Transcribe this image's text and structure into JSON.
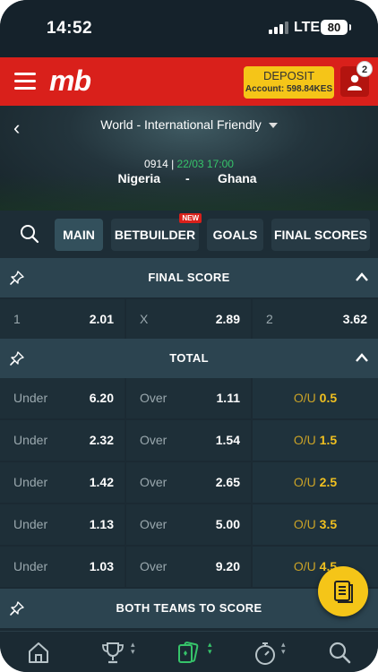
{
  "status_bar": {
    "time": "14:52",
    "network": "LTE",
    "battery": "80"
  },
  "header": {
    "logo": "mb",
    "deposit_label": "DEPOSIT",
    "account_balance": "Account: 598.84KES",
    "notification_count": "2"
  },
  "event": {
    "league": "World - International Friendly",
    "event_id": "0914 |",
    "datetime": "22/03 17:00",
    "home_team": "Nigeria",
    "separator": "-",
    "away_team": "Ghana"
  },
  "tabs": [
    {
      "label": "MAIN",
      "active": true
    },
    {
      "label": "BETBUILDER",
      "badge": "NEW"
    },
    {
      "label": "GOALS"
    },
    {
      "label": "FINAL SCORES"
    }
  ],
  "final_score": {
    "title": "FINAL SCORE",
    "outcomes": [
      {
        "label": "1",
        "odd": "2.01"
      },
      {
        "label": "X",
        "odd": "2.89"
      },
      {
        "label": "2",
        "odd": "3.62"
      }
    ]
  },
  "total": {
    "title": "TOTAL",
    "rows": [
      {
        "under_label": "Under",
        "under": "6.20",
        "over_label": "Over",
        "over": "1.11",
        "line_label": "O/U",
        "line": "0.5"
      },
      {
        "under_label": "Under",
        "under": "2.32",
        "over_label": "Over",
        "over": "1.54",
        "line_label": "O/U",
        "line": "1.5"
      },
      {
        "under_label": "Under",
        "under": "1.42",
        "over_label": "Over",
        "over": "2.65",
        "line_label": "O/U",
        "line": "2.5"
      },
      {
        "under_label": "Under",
        "under": "1.13",
        "over_label": "Over",
        "over": "5.00",
        "line_label": "O/U",
        "line": "3.5"
      },
      {
        "under_label": "Under",
        "under": "1.03",
        "over_label": "Over",
        "over": "9.20",
        "line_label": "O/U",
        "line": "4.5"
      }
    ]
  },
  "btts": {
    "title": "BOTH TEAMS TO SCORE"
  },
  "bottom_nav": [
    {
      "icon": "home-icon"
    },
    {
      "icon": "trophy-icon"
    },
    {
      "icon": "casino-cards-icon",
      "active_color": "#36c46a"
    },
    {
      "icon": "stopwatch-icon"
    },
    {
      "icon": "search-icon"
    }
  ],
  "colors": {
    "brand_red": "#d9201b",
    "accent_yellow": "#f5c518",
    "green": "#36c46a"
  }
}
